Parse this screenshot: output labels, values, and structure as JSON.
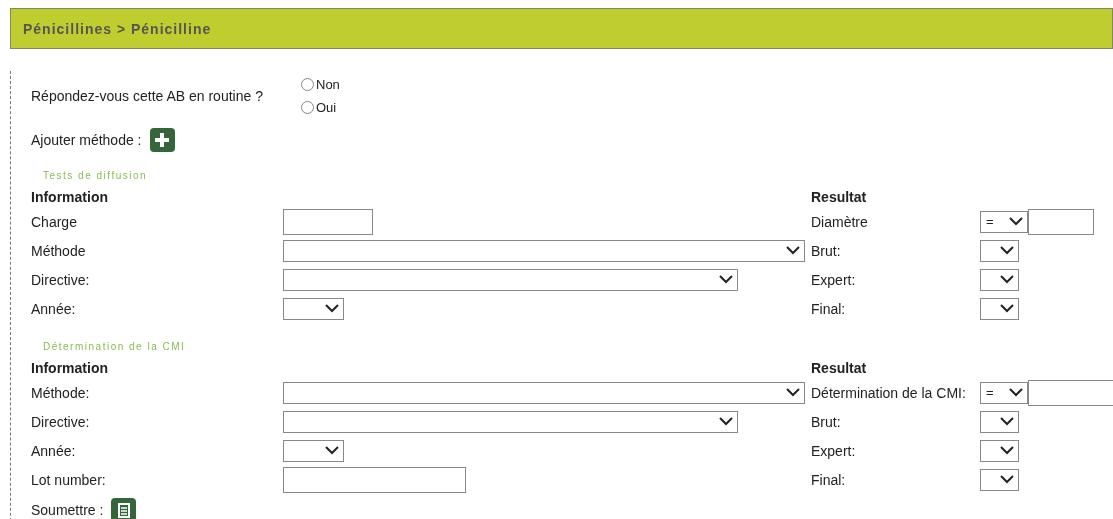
{
  "header": {
    "title": "Pénicillines > Pénicilline"
  },
  "question": {
    "label": "Répondez-vous cette AB en routine ?",
    "options": [
      {
        "label": "Non",
        "selected": false
      },
      {
        "label": "Oui",
        "selected": false
      }
    ]
  },
  "add_method": {
    "label": "Ajouter méthode :"
  },
  "sections": [
    {
      "title": "Tests de diffusion",
      "info_heading": "Information",
      "result_heading": "Resultat",
      "rows": [
        {
          "info": {
            "label": "Charge",
            "kind": "text"
          },
          "result": {
            "label": "Diamètre",
            "kind": "compare",
            "operator": "=",
            "wide": false
          }
        },
        {
          "info": {
            "label": "Méthode",
            "kind": "select"
          },
          "result": {
            "label": "Brut:",
            "kind": "select"
          }
        },
        {
          "info": {
            "label": "Directive:",
            "kind": "select"
          },
          "result": {
            "label": "Expert:",
            "kind": "select"
          }
        },
        {
          "info": {
            "label": "Année:",
            "kind": "select"
          },
          "result": {
            "label": "Final:",
            "kind": "select"
          }
        }
      ]
    },
    {
      "title": "Détermination de la CMI",
      "info_heading": "Information",
      "result_heading": "Resultat",
      "rows": [
        {
          "info": {
            "label": "Méthode:",
            "kind": "select"
          },
          "result": {
            "label": "Détermination de la CMI:",
            "kind": "compare",
            "operator": "=",
            "wide": true
          }
        },
        {
          "info": {
            "label": "Directive:",
            "kind": "select"
          },
          "result": {
            "label": "Brut:",
            "kind": "select"
          }
        },
        {
          "info": {
            "label": "Année:",
            "kind": "select"
          },
          "result": {
            "label": "Expert:",
            "kind": "select"
          }
        },
        {
          "info": {
            "label": "Lot number:",
            "kind": "text"
          },
          "result": {
            "label": "Final:",
            "kind": "select"
          }
        }
      ]
    }
  ],
  "submit": {
    "label": "Soumettre :"
  }
}
